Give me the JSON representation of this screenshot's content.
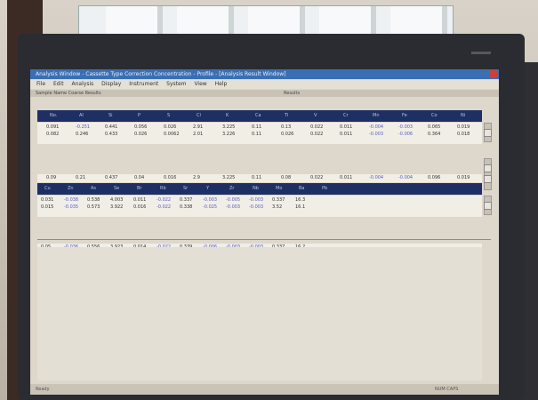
{
  "app": {
    "title": "Analysis Window - Cassette Type Correction Concentration - Profile - [Analysis Result Window]",
    "menu": [
      "File",
      "Edit",
      "Analysis",
      "Display",
      "Instrument",
      "System",
      "View",
      "Help"
    ],
    "sub_left": "Sample Name  Coarse Results",
    "sub_center": "Results"
  },
  "table1": {
    "header": [
      "No.",
      "Al",
      "Si",
      "P",
      "S",
      "Cl",
      "K",
      "Ca",
      "Ti",
      "V",
      "Cr",
      "Mn",
      "Fe",
      "Co",
      "Ni"
    ],
    "rows": [
      [
        "0.091",
        "-0.251",
        "0.441",
        "0.056",
        "0.026",
        "2.91",
        "3.225",
        "0.11",
        "0.13",
        "0.022",
        "0.011",
        "-0.004",
        "-0.003",
        "0.065",
        "0.019"
      ],
      [
        "0.082",
        "0.246",
        "0.433",
        "0.026",
        "0.0062",
        "2.01",
        "3.226",
        "0.11",
        "0.026",
        "0.022",
        "0.011",
        "-0.003",
        "-0.006",
        "0.364",
        "0.018"
      ]
    ],
    "summary": [
      "0.09",
      "0.21",
      "0.437",
      "0.04",
      "0.016",
      "2.9",
      "3.225",
      "0.11",
      "0.08",
      "0.022",
      "0.011",
      "-0.004",
      "-0.004",
      "0.096",
      "0.019"
    ]
  },
  "table2": {
    "header": [
      "Cu",
      "Zn",
      "As",
      "Se",
      "Br",
      "Rb",
      "Sr",
      "Y",
      "Zr",
      "Nb",
      "Mo",
      "Ba",
      "Pb"
    ],
    "rows": [
      [
        "0.031",
        "-0.038",
        "0.538",
        "4.003",
        "0.011",
        "-0.022",
        "0.337",
        "-0.003",
        "-0.005",
        "-0.003",
        "0.337",
        "16.3"
      ],
      [
        "0.015",
        "-0.035",
        "0.573",
        "3.922",
        "0.016",
        "-0.022",
        "0.338",
        "-0.025",
        "-0.003",
        "-0.003",
        "3.52",
        "16.1"
      ]
    ],
    "summary": [
      "0.05",
      "-0.036",
      "0.556",
      "3.923",
      "0.014",
      "-0.022",
      "0.339",
      "-0.006",
      "-0.003",
      "-0.003",
      "0.337",
      "16.2"
    ]
  },
  "status": {
    "left": "Ready",
    "right": "NUM  CAPS"
  },
  "colors": {
    "header_bg": "#1e2f64",
    "negative_value": "#5a5ec0",
    "titlebar": "#3b6fb3"
  }
}
